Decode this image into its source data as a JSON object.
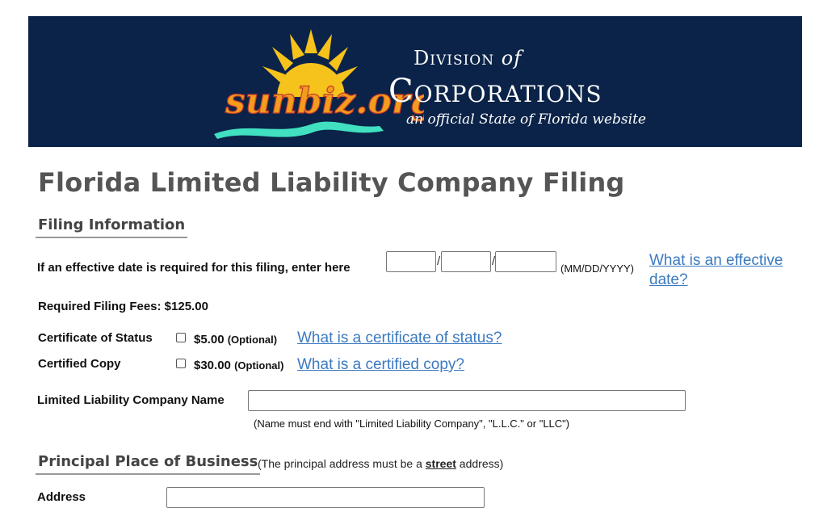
{
  "header": {
    "logo_text": "sunbiz.org",
    "division_word": "Division",
    "division_of": "of",
    "corporations": "Corporations",
    "tagline": "an official State of Florida website",
    "colors": {
      "banner_bg": "#0b2348",
      "sun": "#f6c21c",
      "teal": "#40e0c0",
      "blue": "#3b7ac0"
    }
  },
  "page": {
    "title": "Florida Limited Liability Company Filing"
  },
  "filing_info": {
    "heading": "Filing Information",
    "effective_date_label": "If an effective date is required for this filing, enter here",
    "date_separator": "/",
    "date_format_hint": "(MM/DD/YYYY)",
    "effective_date_link": "What is an effective date?",
    "month_value": "",
    "day_value": "",
    "year_value": "",
    "required_fees": "Required Filing Fees: $125.00",
    "certificate_label": "Certificate of Status",
    "certificate_fee": "$5.00",
    "certificate_optional": "(Optional)",
    "certificate_link": "What is a certificate of status?",
    "certificate_checked": false,
    "certified_copy_label": "Certified Copy",
    "certified_copy_fee": "$30.00",
    "certified_copy_optional": "(Optional)",
    "certified_copy_link": "What is a certified copy?",
    "certified_copy_checked": false,
    "llc_name_label": "Limited Liability Company Name",
    "llc_name_value": "",
    "llc_name_note": "(Name must end with \"Limited Liability Company\", \"L.L.C.\" or \"LLC\")"
  },
  "principal_place": {
    "heading": "Principal Place of Business",
    "note_prefix": "(The principal address must be a ",
    "note_bold": "street",
    "note_suffix": " address)",
    "address_label": "Address",
    "address_value": ""
  }
}
